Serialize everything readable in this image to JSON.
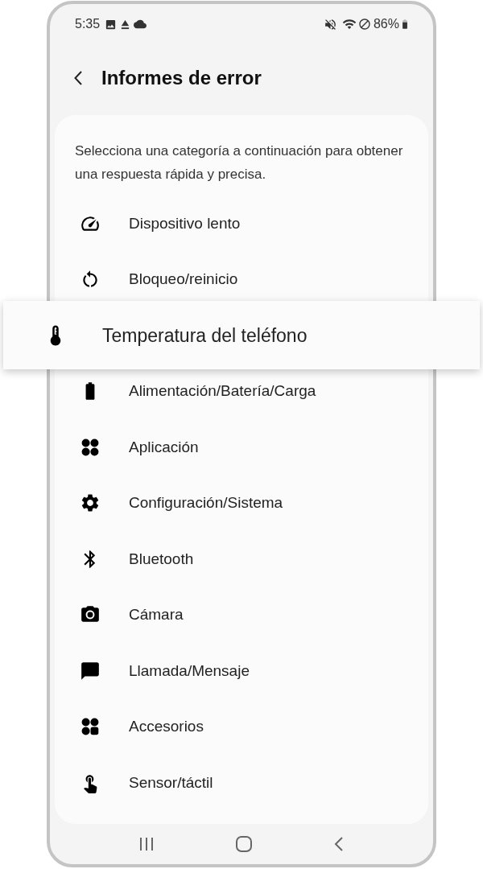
{
  "status_bar": {
    "time": "5:35",
    "battery": "86%"
  },
  "header": {
    "title": "Informes de error"
  },
  "description": "Selecciona una categoría a continuación para obtener una respuesta rápida y precisa.",
  "categories": [
    {
      "label": "Dispositivo lento",
      "selected": false
    },
    {
      "label": "Bloqueo/reinicio",
      "selected": false
    },
    {
      "label": "Temperatura del teléfono",
      "selected": true
    },
    {
      "label": "Alimentación/Batería/Carga",
      "selected": false
    },
    {
      "label": "Aplicación",
      "selected": false
    },
    {
      "label": "Configuración/Sistema",
      "selected": false
    },
    {
      "label": "Bluetooth",
      "selected": false
    },
    {
      "label": "Cámara",
      "selected": false
    },
    {
      "label": "Llamada/Mensaje",
      "selected": false
    },
    {
      "label": "Accesorios",
      "selected": false
    },
    {
      "label": "Sensor/táctil",
      "selected": false
    }
  ]
}
